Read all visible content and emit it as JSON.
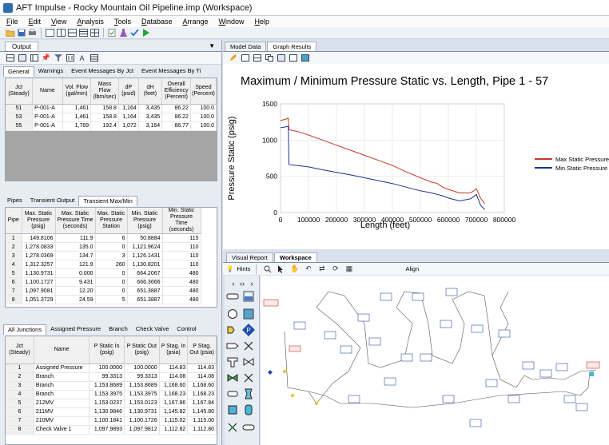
{
  "window": {
    "title": "AFT Impulse - Rocky Mountain Oil Pipeline.imp (Workspace)"
  },
  "menu": [
    "File",
    "Edit",
    "View",
    "Analysis",
    "Tools",
    "Database",
    "Arrange",
    "Window",
    "Help"
  ],
  "output_panel": {
    "tab": "Output",
    "tabs": [
      "General",
      "Warnings",
      "Event Messages By Jct",
      "Event Messages By Ti"
    ],
    "general_table": {
      "headers": [
        "Jct (Steady)",
        "Name",
        "Vol. Flow (gal/min)",
        "Mass Flow (lbm/sec)",
        "dP (psid)",
        "dH (feet)",
        "Overall Efficiency (Percent)",
        "Speed (Percent)"
      ],
      "rows": [
        [
          "51",
          "P-001-A",
          "1,461",
          "158.8",
          "1,164",
          "3,435",
          "86.22",
          "100.0"
        ],
        [
          "53",
          "P-001-A",
          "1,461",
          "158.8",
          "1,164",
          "3,435",
          "86.22",
          "100.0"
        ],
        [
          "55",
          "P-001-A",
          "1,769",
          "192.4",
          "1,072",
          "3,164",
          "86.77",
          "100.0"
        ]
      ]
    },
    "pipe_tabs": [
      "Pipes",
      "Transient Output",
      "Transient Max/Min"
    ],
    "pipe_table": {
      "headers": [
        "Pipe",
        "Max. Static Pressure (psig)",
        "Max. Static Pressure Time (seconds)",
        "Max. Static Pressure Station",
        "Min. Static Pressure (psig)",
        "Min. Static Pressure Time (seconds)"
      ],
      "rows": [
        [
          "1",
          "149.8106",
          "111.9",
          "6",
          "50.8884",
          "115"
        ],
        [
          "2",
          "1,278.0833",
          "135.0",
          "0",
          "1,121.9624",
          "110"
        ],
        [
          "3",
          "1,278.0369",
          "134.7",
          "3",
          "1,126.1431",
          "110"
        ],
        [
          "4",
          "1,312.3257",
          "121.9",
          "260",
          "1,130.8201",
          "110"
        ],
        [
          "5",
          "1,130.9731",
          "0.000",
          "0",
          "664.2067",
          "480"
        ],
        [
          "6",
          "1,100.1727",
          "9.431",
          "0",
          "666.3666",
          "480"
        ],
        [
          "7",
          "1,097.9081",
          "12.20",
          "0",
          "651.3887",
          "480"
        ],
        [
          "8",
          "1,051.3729",
          "24.59",
          "5",
          "651.3887",
          "480"
        ]
      ]
    },
    "junction_tabs": [
      "All Junctions",
      "Assigned Pressure",
      "Branch",
      "Check Valve",
      "Control"
    ],
    "junction_table": {
      "headers": [
        "Jct (Steady)",
        "Name",
        "P Static In (psig)",
        "P Static Out (psig)",
        "P Stag. In (psia)",
        "P Stag. Out (psia)"
      ],
      "rows": [
        [
          "1",
          "Assigned Pressure",
          "100.0000",
          "100.0000",
          "114.83",
          "114.83"
        ],
        [
          "2",
          "Branch",
          "99.3313",
          "99.3313",
          "114.08",
          "114.08"
        ],
        [
          "3",
          "Branch",
          "1,153.8689",
          "1,153.8689",
          "1,168.60",
          "1,168.60"
        ],
        [
          "4",
          "Branch",
          "1,153.3975",
          "1,153.3975",
          "1,168.23",
          "1,168.23"
        ],
        [
          "5",
          "212MV",
          "1,153.0237",
          "1,153.0123",
          "1,167.86",
          "1,167.84"
        ],
        [
          "6",
          "211MV",
          "1,130.9846",
          "1,130.9731",
          "1,145.82",
          "1,145.80"
        ],
        [
          "7",
          "210MV",
          "1,100.1841",
          "1,100.1726",
          "1,115.02",
          "1,115.00"
        ],
        [
          "8",
          "Check Valve 1",
          "1,097.9893",
          "1,097.9812",
          "1,112.82",
          "1,112.80"
        ]
      ]
    }
  },
  "right_panel": {
    "tabs": [
      "Model Data",
      "Graph Results"
    ],
    "workspace_tabs": [
      "Visual Report",
      "Workspace"
    ],
    "hints_label": "Hints",
    "align_label": "Align"
  },
  "chart_data": {
    "type": "line",
    "title": "Maximum / Minimum Pressure Static vs. Length, Pipe 1 - 57",
    "xlabel": "Length (feet)",
    "ylabel": "Pressure Static (psig)",
    "xlim": [
      0,
      800000
    ],
    "ylim": [
      0,
      1500
    ],
    "xticks": [
      "0",
      "100000",
      "200000",
      "300000",
      "400000",
      "500000",
      "600000",
      "700000",
      "800000"
    ],
    "yticks": [
      "0",
      "500",
      "1000",
      "1500"
    ],
    "legend_position": "right",
    "series": [
      {
        "name": "Max Static Pressure",
        "color": "#c0392b",
        "x": [
          0,
          15000,
          28000,
          30000,
          32000,
          60000,
          100000,
          150000,
          200000,
          250000,
          300000,
          350000,
          400000,
          450000,
          500000,
          540000,
          560000,
          580000,
          600000,
          640000,
          680000,
          700000,
          715000,
          730000
        ],
        "y": [
          1270,
          1285,
          1300,
          1150,
          1140,
          1120,
          1070,
          1000,
          930,
          860,
          790,
          720,
          650,
          560,
          480,
          420,
          400,
          350,
          320,
          270,
          270,
          330,
          200,
          120
        ]
      },
      {
        "name": "Min Static Pressure",
        "color": "#1f2f8f",
        "x": [
          0,
          15000,
          28000,
          30000,
          32000,
          60000,
          100000,
          150000,
          200000,
          250000,
          300000,
          350000,
          400000,
          450000,
          500000,
          540000,
          560000,
          580000,
          600000,
          640000,
          680000,
          700000,
          715000,
          730000
        ],
        "y": [
          1170,
          1180,
          1190,
          670,
          660,
          650,
          630,
          590,
          555,
          520,
          480,
          440,
          400,
          350,
          300,
          270,
          250,
          230,
          200,
          160,
          190,
          250,
          100,
          40
        ]
      }
    ]
  }
}
